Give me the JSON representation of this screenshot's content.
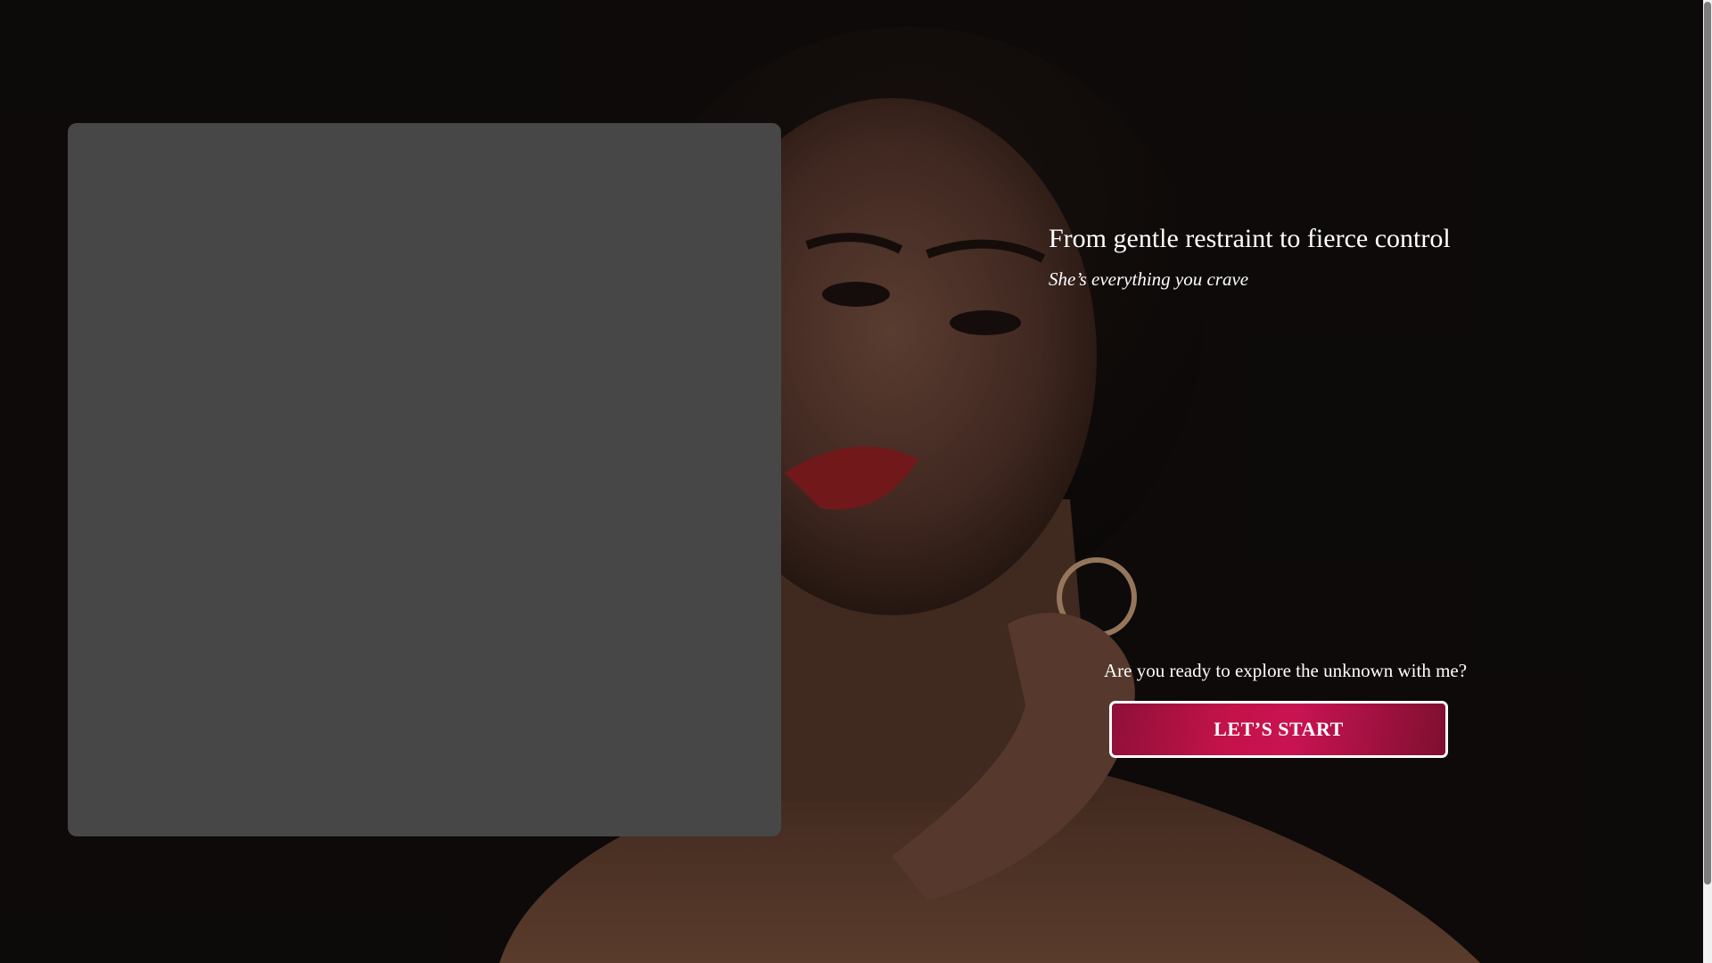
{
  "hero": {
    "headline": "From gentle restraint to fierce control",
    "subheadline": "She’s everything you crave"
  },
  "cta": {
    "question": "Are you ready to explore the unknown with me?",
    "button_label": "LET’S START"
  },
  "colors": {
    "page_background": "#100d0c",
    "panel": "#474747",
    "button_accent": "#c4124a",
    "text": "#ffffff"
  }
}
